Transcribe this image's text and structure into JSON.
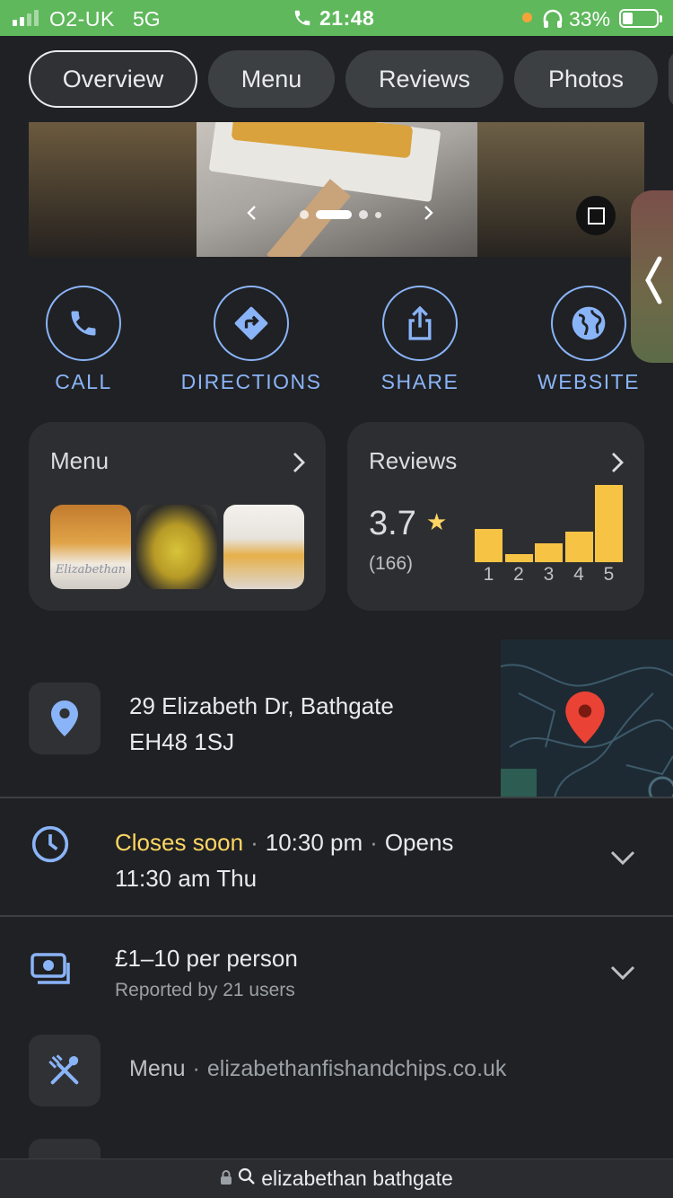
{
  "status_bar": {
    "carrier": "O2-UK",
    "network": "5G",
    "time": "21:48",
    "battery": "33%"
  },
  "tabs": [
    {
      "label": "Overview",
      "active": true
    },
    {
      "label": "Menu"
    },
    {
      "label": "Reviews"
    },
    {
      "label": "Photos"
    }
  ],
  "actions": {
    "call": "CALL",
    "directions": "DIRECTIONS",
    "share": "SHARE",
    "website": "WEBSITE"
  },
  "menu_card": {
    "title": "Menu",
    "thumb_text": "Elizabethan"
  },
  "reviews_card": {
    "title": "Reviews",
    "rating": "3.7",
    "count": "(166)",
    "distribution": [
      {
        "star": "1",
        "fraction": 0.43
      },
      {
        "star": "2",
        "fraction": 0.1
      },
      {
        "star": "3",
        "fraction": 0.24
      },
      {
        "star": "4",
        "fraction": 0.39
      },
      {
        "star": "5",
        "fraction": 1.0
      }
    ],
    "bar_color": "#f6c344"
  },
  "address": {
    "line1": "29 Elizabeth Dr, Bathgate",
    "line2": "EH48 1SJ"
  },
  "hours": {
    "status": "Closes soon",
    "closes_time": "10:30 pm",
    "opens_label": "Opens",
    "opens_time": "11:30 am Thu"
  },
  "price": {
    "range": "£1–10 per person",
    "reported": "Reported by 21 users"
  },
  "menu_link": {
    "label": "Menu",
    "url": "elizabethanfishandchips.co.uk"
  },
  "url_bar": {
    "query": "elizabethan bathgate"
  },
  "colors": {
    "accent": "#8ab4f8",
    "status_bar": "#5fb85c",
    "closes_soon": "#fdd663",
    "map_pin": "#ea4335"
  }
}
